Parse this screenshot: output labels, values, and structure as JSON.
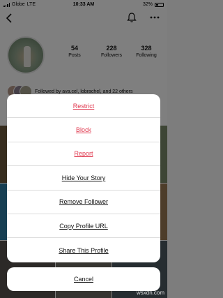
{
  "status_bar": {
    "carrier": "Globe",
    "network": "LTE",
    "time": "10:33 AM",
    "battery": "32%"
  },
  "profile": {
    "stats": [
      {
        "value": "54",
        "label": "Posts"
      },
      {
        "value": "228",
        "label": "Followers"
      },
      {
        "value": "328",
        "label": "Following"
      }
    ],
    "followed_by": "Followed by ava.cel, lobrachel, and 22 others"
  },
  "action_sheet": {
    "items": [
      {
        "label": "Restrict",
        "style": "destructive"
      },
      {
        "label": "Block",
        "style": "destructive"
      },
      {
        "label": "Report",
        "style": "destructive"
      },
      {
        "label": "Hide Your Story",
        "style": "default"
      },
      {
        "label": "Remove Follower",
        "style": "default"
      },
      {
        "label": "Copy Profile URL",
        "style": "default"
      },
      {
        "label": "Share This Profile",
        "style": "default"
      }
    ],
    "cancel_label": "Cancel"
  },
  "watermark": "wsxdn.com",
  "colors": {
    "destructive": "#e0394f",
    "overlay": "rgba(0,0,0,0.5)"
  }
}
